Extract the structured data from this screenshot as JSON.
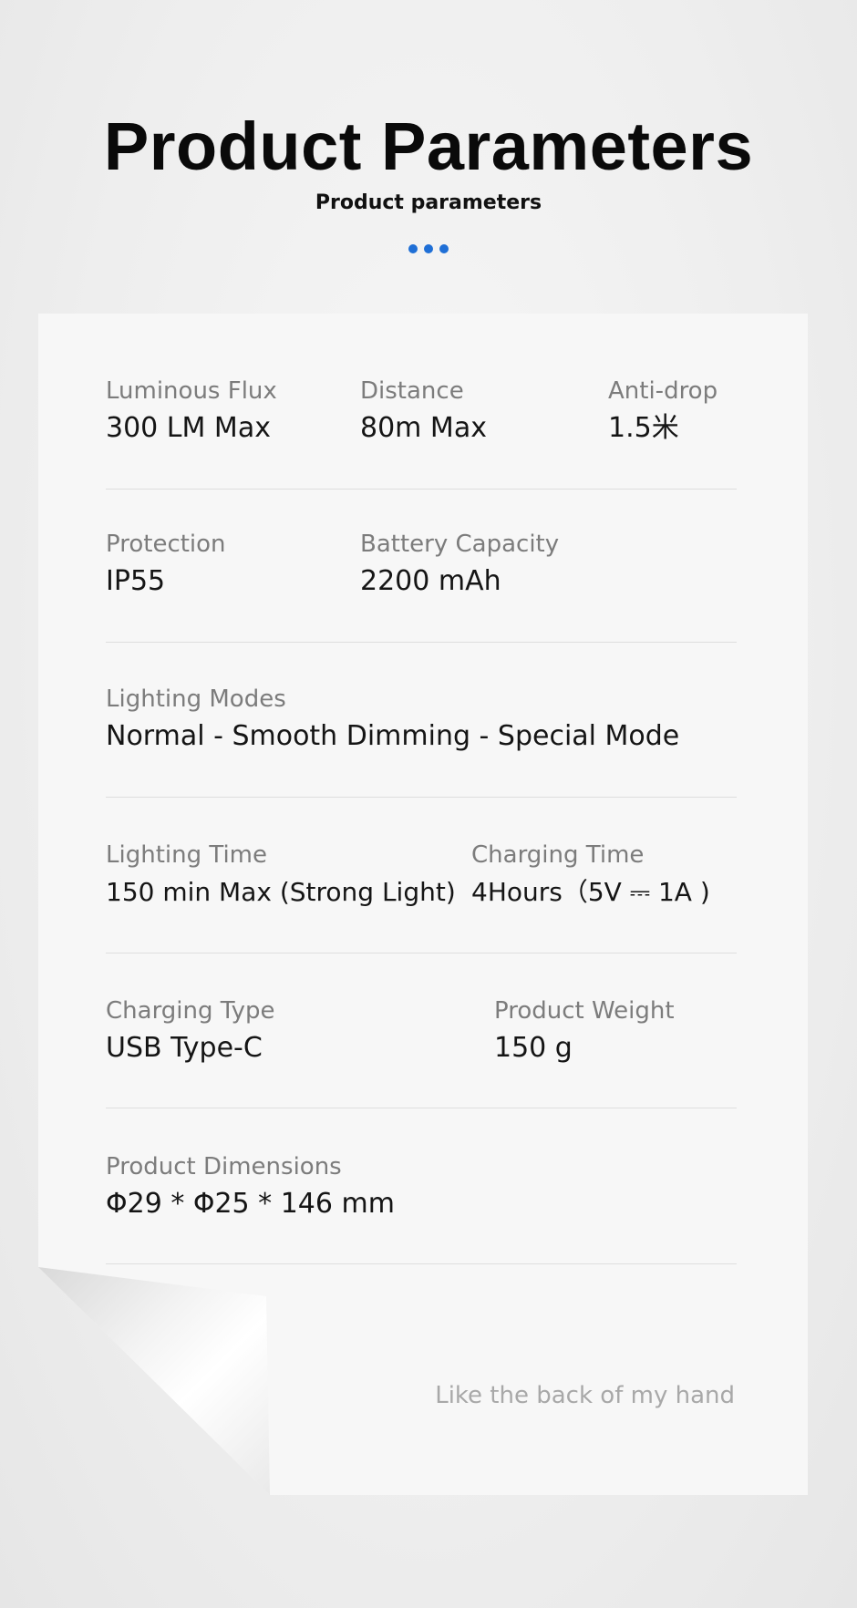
{
  "header": {
    "title": "Product Parameters",
    "subtitle": "Product parameters"
  },
  "accent_color": "#1f6fd6",
  "params": {
    "luminous_flux": {
      "label": "Luminous Flux",
      "value": "300 LM  Max"
    },
    "distance": {
      "label": "Distance",
      "value": "80m Max"
    },
    "anti_drop": {
      "label": "Anti-drop",
      "value": "1.5米"
    },
    "protection": {
      "label": "Protection",
      "value": "IP55"
    },
    "battery_capacity": {
      "label": "Battery Capacity",
      "value": "2200 mAh"
    },
    "lighting_modes": {
      "label": "Lighting Modes",
      "value": "Normal - Smooth Dimming - Special Mode"
    },
    "lighting_time": {
      "label": "Lighting Time",
      "value": "150 min Max (Strong Light)"
    },
    "charging_time": {
      "label": "Charging Time",
      "value": "4Hours（5V ⎓ 1A )"
    },
    "charging_type": {
      "label": "Charging Type",
      "value": "USB Type-C"
    },
    "product_weight": {
      "label": "Product Weight",
      "value": "150 g"
    },
    "product_dimensions": {
      "label": "Product Dimensions",
      "value": "Φ29 * Φ25 * 146 mm"
    }
  },
  "footer": {
    "tagline": "Like the back of my hand"
  }
}
